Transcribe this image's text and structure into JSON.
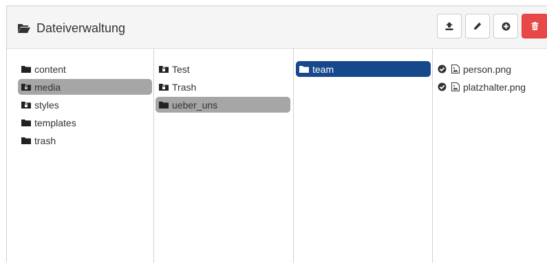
{
  "header": {
    "title": "Dateiverwaltung",
    "icon": "folder-open-icon"
  },
  "toolbar": {
    "buttons": [
      {
        "icon": "upload-icon"
      },
      {
        "icon": "pencil-icon"
      },
      {
        "icon": "plus-circle-icon"
      },
      {
        "icon": "trash-icon",
        "color": "#e84848"
      }
    ]
  },
  "columns": {
    "col1": [
      {
        "label": "content",
        "state": "normal"
      },
      {
        "label": "media",
        "state": "selected"
      },
      {
        "label": "styles",
        "state": "normal"
      },
      {
        "label": "templates",
        "state": "normal"
      },
      {
        "label": "trash",
        "state": "normal"
      }
    ],
    "col2": [
      {
        "label": "Test",
        "state": "normal"
      },
      {
        "label": "Trash",
        "state": "normal"
      },
      {
        "label": "ueber_uns",
        "state": "selected"
      }
    ],
    "col3": [
      {
        "label": "team",
        "state": "active"
      }
    ],
    "col4": [
      {
        "label": "person.png",
        "icon": "image-file-icon",
        "checked": true
      },
      {
        "label": "platzhalter.png",
        "icon": "image-file-icon",
        "checked": true
      }
    ]
  },
  "colors": {
    "selected_gray": "#a6a6a6",
    "selected_blue": "#16488c",
    "danger": "#e84848"
  }
}
